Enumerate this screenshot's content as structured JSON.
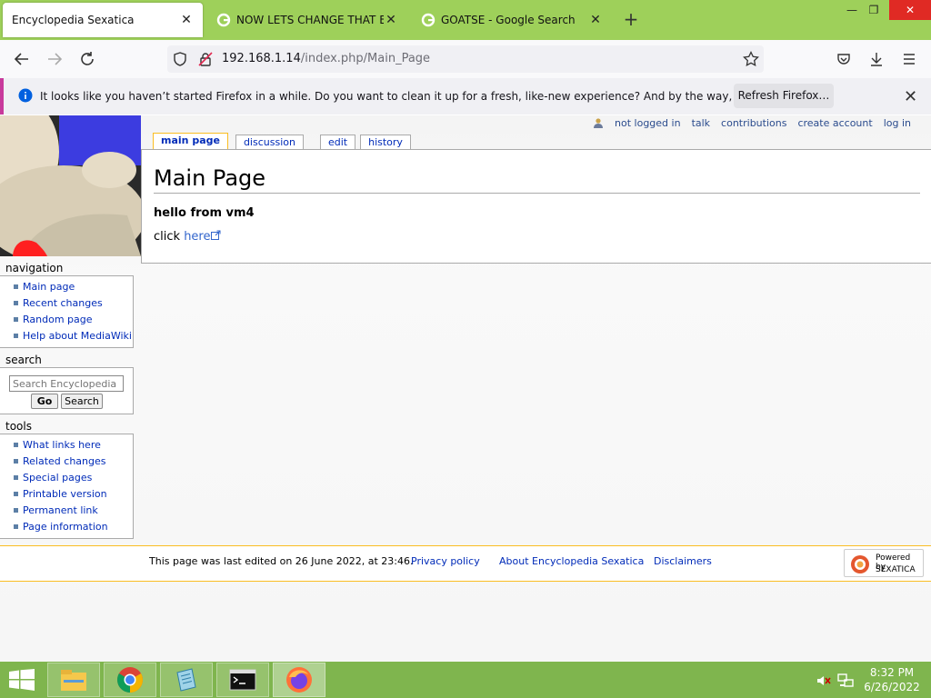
{
  "browser": {
    "tabs": [
      {
        "title": "Encyclopedia Sexatica",
        "close": "✕"
      },
      {
        "title": "NOW LETS CHANGE THAT BG",
        "close": "✕"
      },
      {
        "title": "GOATSE - Google Search",
        "close": "✕"
      }
    ],
    "new_tab": "+",
    "window_controls": {
      "minimize": "—",
      "restore": "❐",
      "close": "✕"
    },
    "url": {
      "host": "192.168.1.14",
      "path": "/index.php/Main_Page"
    },
    "notification": {
      "text": "It looks like you haven’t started Firefox in a while. Do you want to clean it up for a fresh, like-new experience? And by the way, welcome back!",
      "button": "Refresh Firefox…",
      "close": "✕"
    }
  },
  "wiki": {
    "personal": [
      "not logged in",
      "talk",
      "contributions",
      "create account",
      "log in"
    ],
    "tabs": {
      "main": "main page",
      "discussion": "discussion",
      "edit": "edit",
      "history": "history"
    },
    "heading": "Main Page",
    "hello": "hello from vm4",
    "click_prefix": "click ",
    "click_link": "here",
    "navigation": {
      "title": "navigation",
      "items": [
        "Main page",
        "Recent changes",
        "Random page",
        "Help about MediaWiki"
      ]
    },
    "search": {
      "title": "search",
      "placeholder": "Search Encyclopedia Sexatica",
      "go": "Go",
      "search": "Search"
    },
    "tools": {
      "title": "tools",
      "items": [
        "What links here",
        "Related changes",
        "Special pages",
        "Printable version",
        "Permanent link",
        "Page information"
      ]
    },
    "footer": {
      "last_edited": "This page was last edited on 26 June 2022, at 23:46.",
      "privacy": "Privacy policy",
      "about": "About Encyclopedia Sexatica",
      "disclaimers": "Disclaimers",
      "powered_by": "Powered by",
      "powered_brand": "SEXATICA"
    }
  },
  "taskbar": {
    "time": "8:32 PM",
    "date": "6/26/2022"
  }
}
